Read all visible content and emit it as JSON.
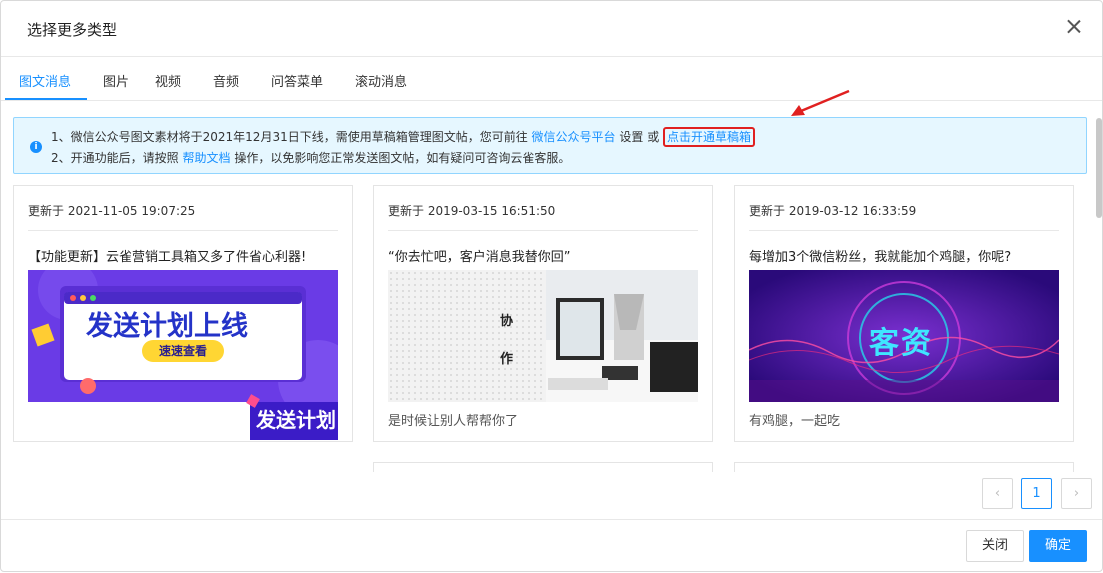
{
  "dialog": {
    "title": "选择更多类型"
  },
  "tabs": [
    {
      "label": "图文消息",
      "active": true
    },
    {
      "label": "图片"
    },
    {
      "label": "视频"
    },
    {
      "label": "音频"
    },
    {
      "label": "问答菜单"
    },
    {
      "label": "滚动消息"
    }
  ],
  "notice": {
    "line1_prefix": "1、微信公众号图文素材将于2021年12月31日下线，需使用草稿箱管理图文帖，您可前往",
    "line1_link": "微信公众号平台",
    "line1_mid": "设置 或",
    "line1_link2": "点击开通草稿箱",
    "line2_prefix": "2、开通功能后，请按照",
    "line2_link": "帮助文档",
    "line2_suffix": "操作，以免影响您正常发送图文帖，如有疑问可咨询云雀客服。"
  },
  "cards": [
    {
      "updated": "更新于 2021-11-05 19:07:25",
      "title": "【功能更新】云雀营销工具箱又多了件省心利器!",
      "banner_text": "发送计划上线",
      "banner_button": "速速查看",
      "banner_side": "发送计划",
      "desc": ""
    },
    {
      "updated": "更新于 2019-03-15 16:51:50",
      "title": "“你去忙吧，客户消息我替你回”",
      "image_text1": "协",
      "image_text2": "作",
      "desc": "是时候让别人帮帮你了"
    },
    {
      "updated": "更新于 2019-03-12 16:33:59",
      "title": "每增加3个微信粉丝，我就能加个鸡腿，你呢?",
      "image_text": "客资",
      "desc": "有鸡腿，一起吃"
    }
  ],
  "pagination": {
    "prev": "‹",
    "current": "1",
    "next": "›"
  },
  "footer": {
    "close_label": "关闭",
    "confirm_label": "确定"
  },
  "colors": {
    "primary": "#1890ff",
    "highlight": "#e02020"
  }
}
